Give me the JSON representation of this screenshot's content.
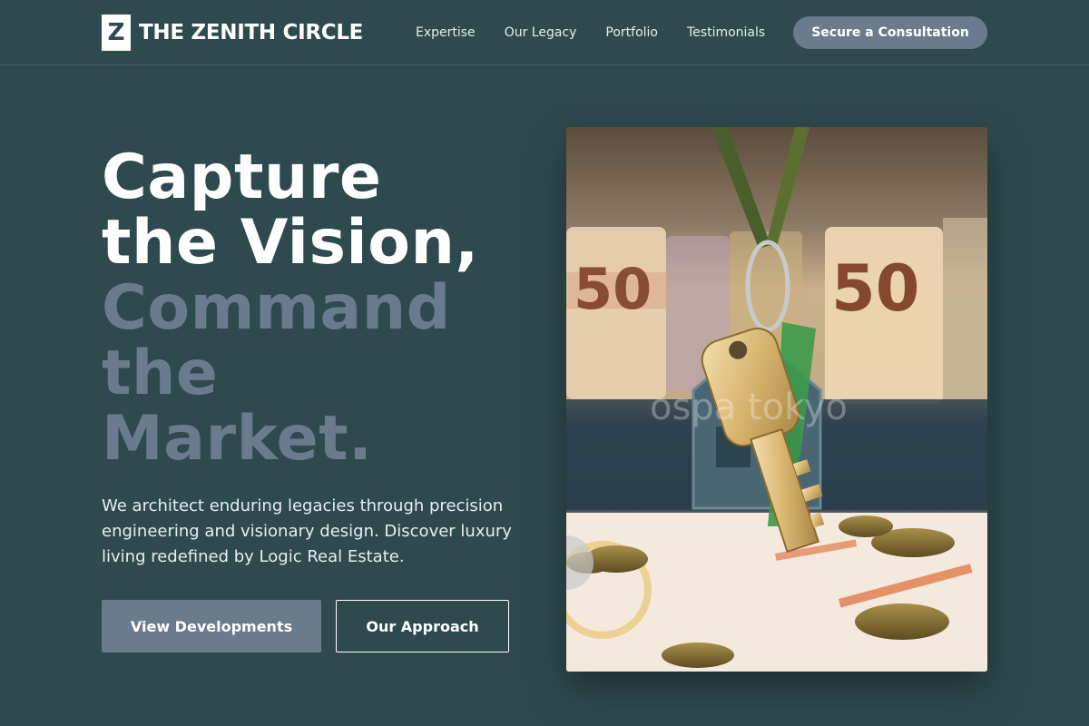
{
  "brand": {
    "mark": "Z",
    "name": "THE ZENITH CIRCLE"
  },
  "nav": {
    "links": [
      "Expertise",
      "Our Legacy",
      "Portfolio",
      "Testimonials"
    ],
    "cta_label": "Secure a Consultation"
  },
  "hero": {
    "title_line1": "Capture",
    "title_line2": "the Vision,",
    "title_line3": "Command",
    "title_line4": "the",
    "title_line5": "Market.",
    "subtitle": "We architect enduring legacies through precision engineering and visionary design. Discover luxury living redefined by Logic Real Estate.",
    "primary_button": "View Developments",
    "secondary_button": "Our Approach",
    "image_watermark": "ospa tokyo"
  },
  "colors": {
    "background": "#2e4a4f",
    "accent": "#6b7b8e",
    "text": "#ffffff"
  }
}
